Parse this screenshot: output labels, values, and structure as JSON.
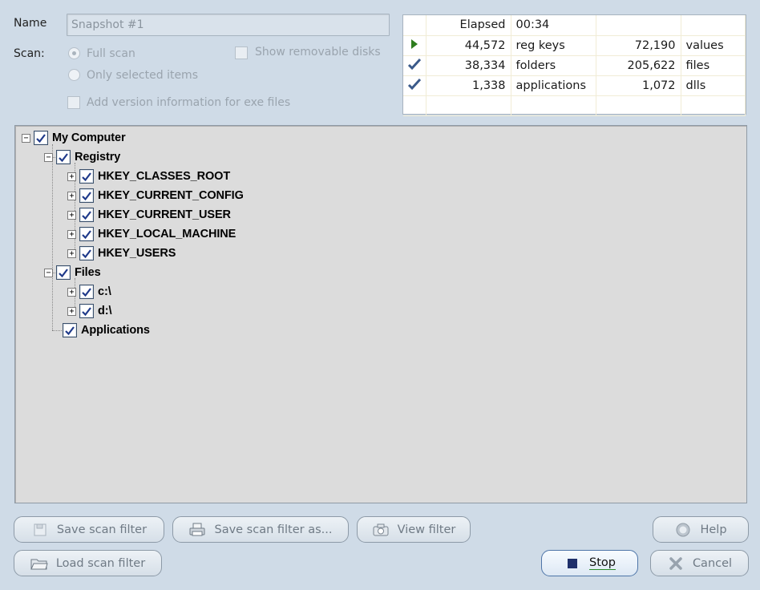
{
  "form": {
    "name_label": "Name",
    "name_value": "Snapshot #1",
    "scan_label": "Scan:",
    "full_scan_label": "Full scan",
    "only_selected_label": "Only selected items",
    "show_removable_label": "Show removable disks",
    "version_info_label": "Add version information for exe files",
    "full_scan_selected": true
  },
  "stats": {
    "elapsed_label": "Elapsed",
    "elapsed_value": "00:34",
    "rows": [
      {
        "icon": "play-arrow-icon",
        "count1": "44,572",
        "label1": "reg keys",
        "count2": "72,190",
        "label2": "values"
      },
      {
        "icon": "checkmark-icon",
        "count1": "38,334",
        "label1": "folders",
        "count2": "205,622",
        "label2": "files"
      },
      {
        "icon": "checkmark-icon",
        "count1": "1,338",
        "label1": "applications",
        "count2": "1,072",
        "label2": "dlls"
      }
    ]
  },
  "tree": {
    "root": "My Computer",
    "registry": "Registry",
    "registry_items": [
      "HKEY_CLASSES_ROOT",
      "HKEY_CURRENT_CONFIG",
      "HKEY_CURRENT_USER",
      "HKEY_LOCAL_MACHINE",
      "HKEY_USERS"
    ],
    "files": "Files",
    "file_items": [
      "c:\\",
      "d:\\"
    ],
    "applications": "Applications"
  },
  "buttons": {
    "save_scan_filter": "Save scan filter",
    "save_scan_filter_as": "Save scan filter as...",
    "view_filter": "View filter",
    "load_scan_filter": "Load scan filter",
    "help": "Help",
    "stop": "Stop",
    "cancel": "Cancel"
  },
  "colors": {
    "background": "#cfdbe7",
    "tree_background": "#dcdcdc",
    "check_color": "#1f3a8a",
    "play_color": "#2e7d1e"
  }
}
